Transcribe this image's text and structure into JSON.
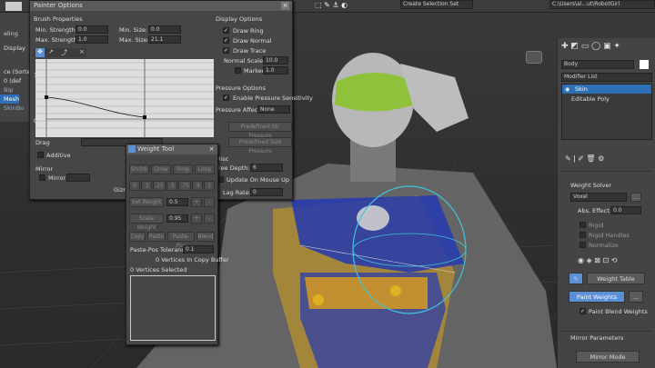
{
  "toolbar": {
    "selection_set": "Create Selection Set",
    "path": "C:\\Users\\al...ut\\RobotGirl"
  },
  "left_panel": {
    "tab1": "Display",
    "tab2": "eling",
    "items": [
      "ce (Sorted",
      "0 (def",
      "Bip",
      "Mesh",
      "SkinBo"
    ]
  },
  "painter_options": {
    "title": "Painter Options",
    "brush_properties": "Brush Properties",
    "min_strength_label": "Min. Strength:",
    "min_strength": "0.0",
    "max_strength_label": "Max. Strength:",
    "max_strength": "1.0",
    "min_size_label": "Min. Size:",
    "min_size": "0.0",
    "max_size_label": "Max. Size:",
    "max_size": "21.1",
    "curve_y_labels": [
      "1",
      "0"
    ],
    "drag_label": "Drag",
    "additive": "Additive",
    "mirror_section": "Mirror",
    "mirror": "Mirror",
    "gizmo": "Gizm",
    "display_options": "Display Options",
    "draw_ring": "Draw Ring",
    "draw_normal": "Draw Normal",
    "draw_trace": "Draw Trace",
    "normal_scale_label": "Normal Scale:",
    "normal_scale": "10.0",
    "marker_label": "Marker",
    "marker": "1.0",
    "pressure_options": "Pressure Options",
    "enable_pressure": "Enable Pressure Sensitivity",
    "pressure_affects_label": "Pressure Affects:",
    "pressure_affects": "None",
    "predef_str": "Predefined Str Pressure",
    "predef_size": "Predefined Size Pressure",
    "misc": "Misc",
    "tree_depth_label": "Tree Depth:",
    "tree_depth": "6",
    "update_on_mouse_up": "Update On Mouse Up",
    "lag_rate_label": "Lag Rate:",
    "lag_rate": "0"
  },
  "weight_tool": {
    "title": "Weight Tool",
    "row1": [
      "Shrink",
      "Grow",
      "Ring",
      "Loop"
    ],
    "row2": [
      "0",
      ".1",
      ".25",
      ".5",
      ".75",
      ".9",
      "1"
    ],
    "set_weight": "Set Weight",
    "set_val": "0.5",
    "plus": "+",
    "minus": "-",
    "scale_weight": "Scale Weight",
    "scale_val": "0.95",
    "row4": [
      "Copy",
      "Paste",
      "Paste-Pos",
      "Blend"
    ],
    "tolerance_label": "Paste-Pos Tolerance",
    "tolerance": "0.1",
    "buffer_info": "0 Vertices In Copy Buffer",
    "selected_info": "0 Vertices Selected"
  },
  "modify_panel": {
    "object_name": "Body",
    "modifier_list": "Modifier List",
    "stack": [
      "Skin",
      "Editable Poly"
    ],
    "weight_solver": "Weight Solver",
    "solver_type": "Voxel",
    "abs_effect_label": "Abs. Effect:",
    "abs_effect": "0.0",
    "rigid": "Rigid",
    "rigid_handles": "Rigid Handles",
    "normalize": "Normalize",
    "weight_table": "Weight Table",
    "paint_weights": "Paint Weights",
    "more": "...",
    "paint_blend": "Paint Blend Weights",
    "mirror_params": "Mirror Parameters",
    "mirror_mode": "Mirror Mode"
  },
  "colors": {
    "accent": "#5b8fd6",
    "skin_yellow": "#e2b21c",
    "weight_blue": "#2438b0",
    "visor_green": "#8fc23a"
  }
}
